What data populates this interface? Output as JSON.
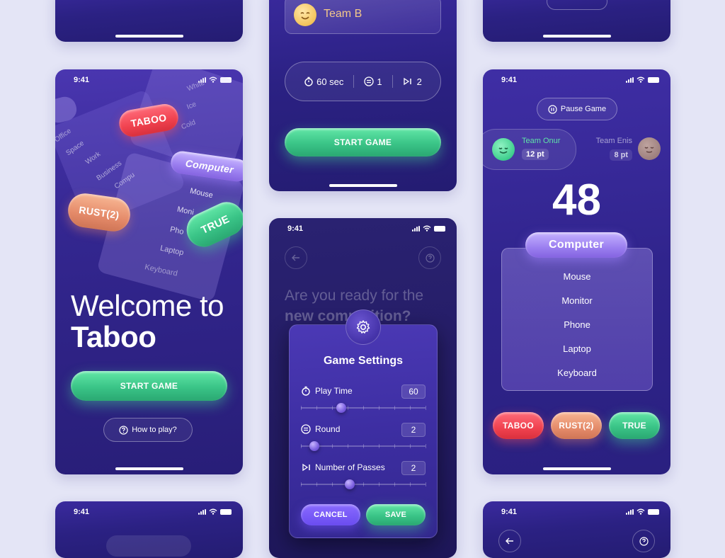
{
  "status_time": "9:41",
  "phone_top_mid": {
    "team_b_label": "Team B",
    "settings_row": {
      "time": "60 sec",
      "rounds": "1",
      "passes": "2"
    },
    "start_button": "START GAME"
  },
  "welcome": {
    "heading_line1": "Welcome to",
    "heading_line2": "Taboo",
    "start_button": "START GAME",
    "how_to_play": "How to play?",
    "deco": {
      "taboo": "TABOO",
      "computer": "Computer",
      "rust": "RUST(2)",
      "true": "TRUE",
      "card_words_back": [
        "White",
        "Ice",
        "Cold"
      ],
      "card_words_left": [
        "Office",
        "Space",
        "Work",
        "Business",
        "Compu"
      ],
      "card_words_front": [
        "Mouse",
        "Moni",
        "Pho",
        "Laptop",
        "Keyboard"
      ]
    }
  },
  "settings_modal": {
    "bg_question_line1": "Are you ready for the",
    "bg_question_line2": "new competition?",
    "title": "Game Settings",
    "play_time_label": "Play Time",
    "play_time_value": "60",
    "round_label": "Round",
    "round_value": "2",
    "passes_label": "Number of Passes",
    "passes_value": "2",
    "cancel_button": "CANCEL",
    "save_button": "SAVE"
  },
  "game": {
    "pause_button": "Pause Game",
    "team_left_name": "Team Onur",
    "team_left_score": "12 pt",
    "team_right_name": "Team Enis",
    "team_right_score": "8 pt",
    "timer": "48",
    "word": "Computer",
    "taboo_words": [
      "Mouse",
      "Monitor",
      "Phone",
      "Laptop",
      "Keyboard"
    ],
    "buttons": {
      "taboo": "TABOO",
      "rust": "RUST(2)",
      "true": "TRUE"
    }
  },
  "colors": {
    "accent_green": "#3ac487",
    "accent_red": "#f0424f",
    "accent_peach": "#e58b6a",
    "accent_lavender": "#9b7ff0",
    "page_bg": "#e4e5f6",
    "phone_bg": "#2b2183"
  }
}
